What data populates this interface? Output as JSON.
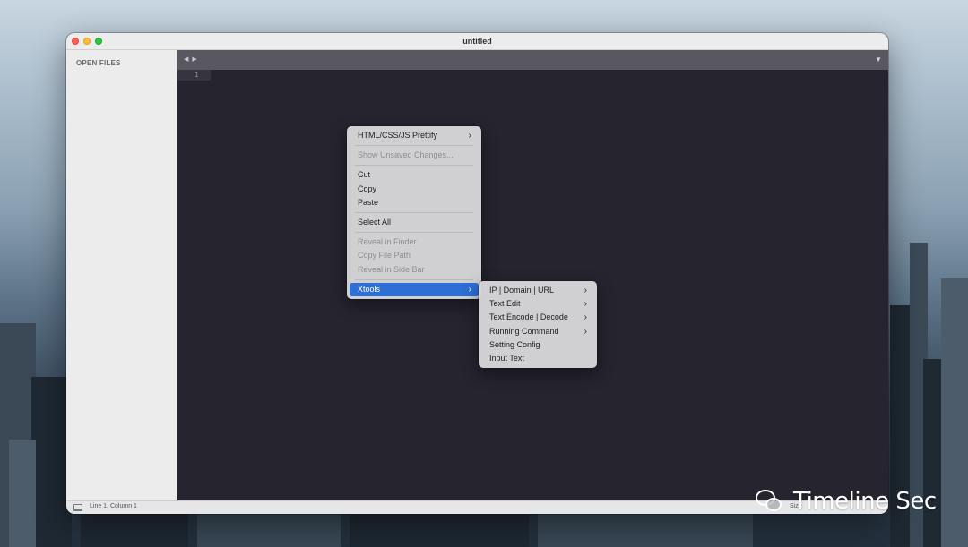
{
  "window": {
    "title": "untitled"
  },
  "sidebar": {
    "heading": "OPEN FILES"
  },
  "tabbar": {
    "nav_arrows": "◀ ▶",
    "dropdown_glyph": "▼"
  },
  "editor": {
    "line_number": "1"
  },
  "statusbar": {
    "position": "Line 1, Column 1",
    "right_text": "Size"
  },
  "context_menu": {
    "items": [
      {
        "label": "HTML/CSS/JS Prettify",
        "submenu": true,
        "enabled": true
      },
      {
        "label": "Show Unsaved Changes...",
        "enabled": false
      },
      {
        "label": "Cut",
        "enabled": true
      },
      {
        "label": "Copy",
        "enabled": true
      },
      {
        "label": "Paste",
        "enabled": true
      },
      {
        "label": "Select All",
        "enabled": true
      },
      {
        "label": "Reveal in Finder",
        "enabled": false
      },
      {
        "label": "Copy File Path",
        "enabled": false
      },
      {
        "label": "Reveal in Side Bar",
        "enabled": false
      },
      {
        "label": "Xtools",
        "submenu": true,
        "enabled": true,
        "highlighted": true
      }
    ],
    "submenu_arrow": "›"
  },
  "xtools_submenu": {
    "items": [
      {
        "label": "IP | Domain | URL",
        "submenu": true
      },
      {
        "label": "Text Edit",
        "submenu": true
      },
      {
        "label": "Text Encode | Decode",
        "submenu": true
      },
      {
        "label": "Running Command",
        "submenu": true
      },
      {
        "label": "Setting Config",
        "submenu": false
      },
      {
        "label": "Input Text",
        "submenu": false
      }
    ]
  },
  "watermark": {
    "text": "Timeline Sec",
    "icon": "wechat-icon"
  },
  "colors": {
    "highlight": "#2e6fd6",
    "editor_bg": "#25242f",
    "tabbar_bg": "#59575f"
  }
}
